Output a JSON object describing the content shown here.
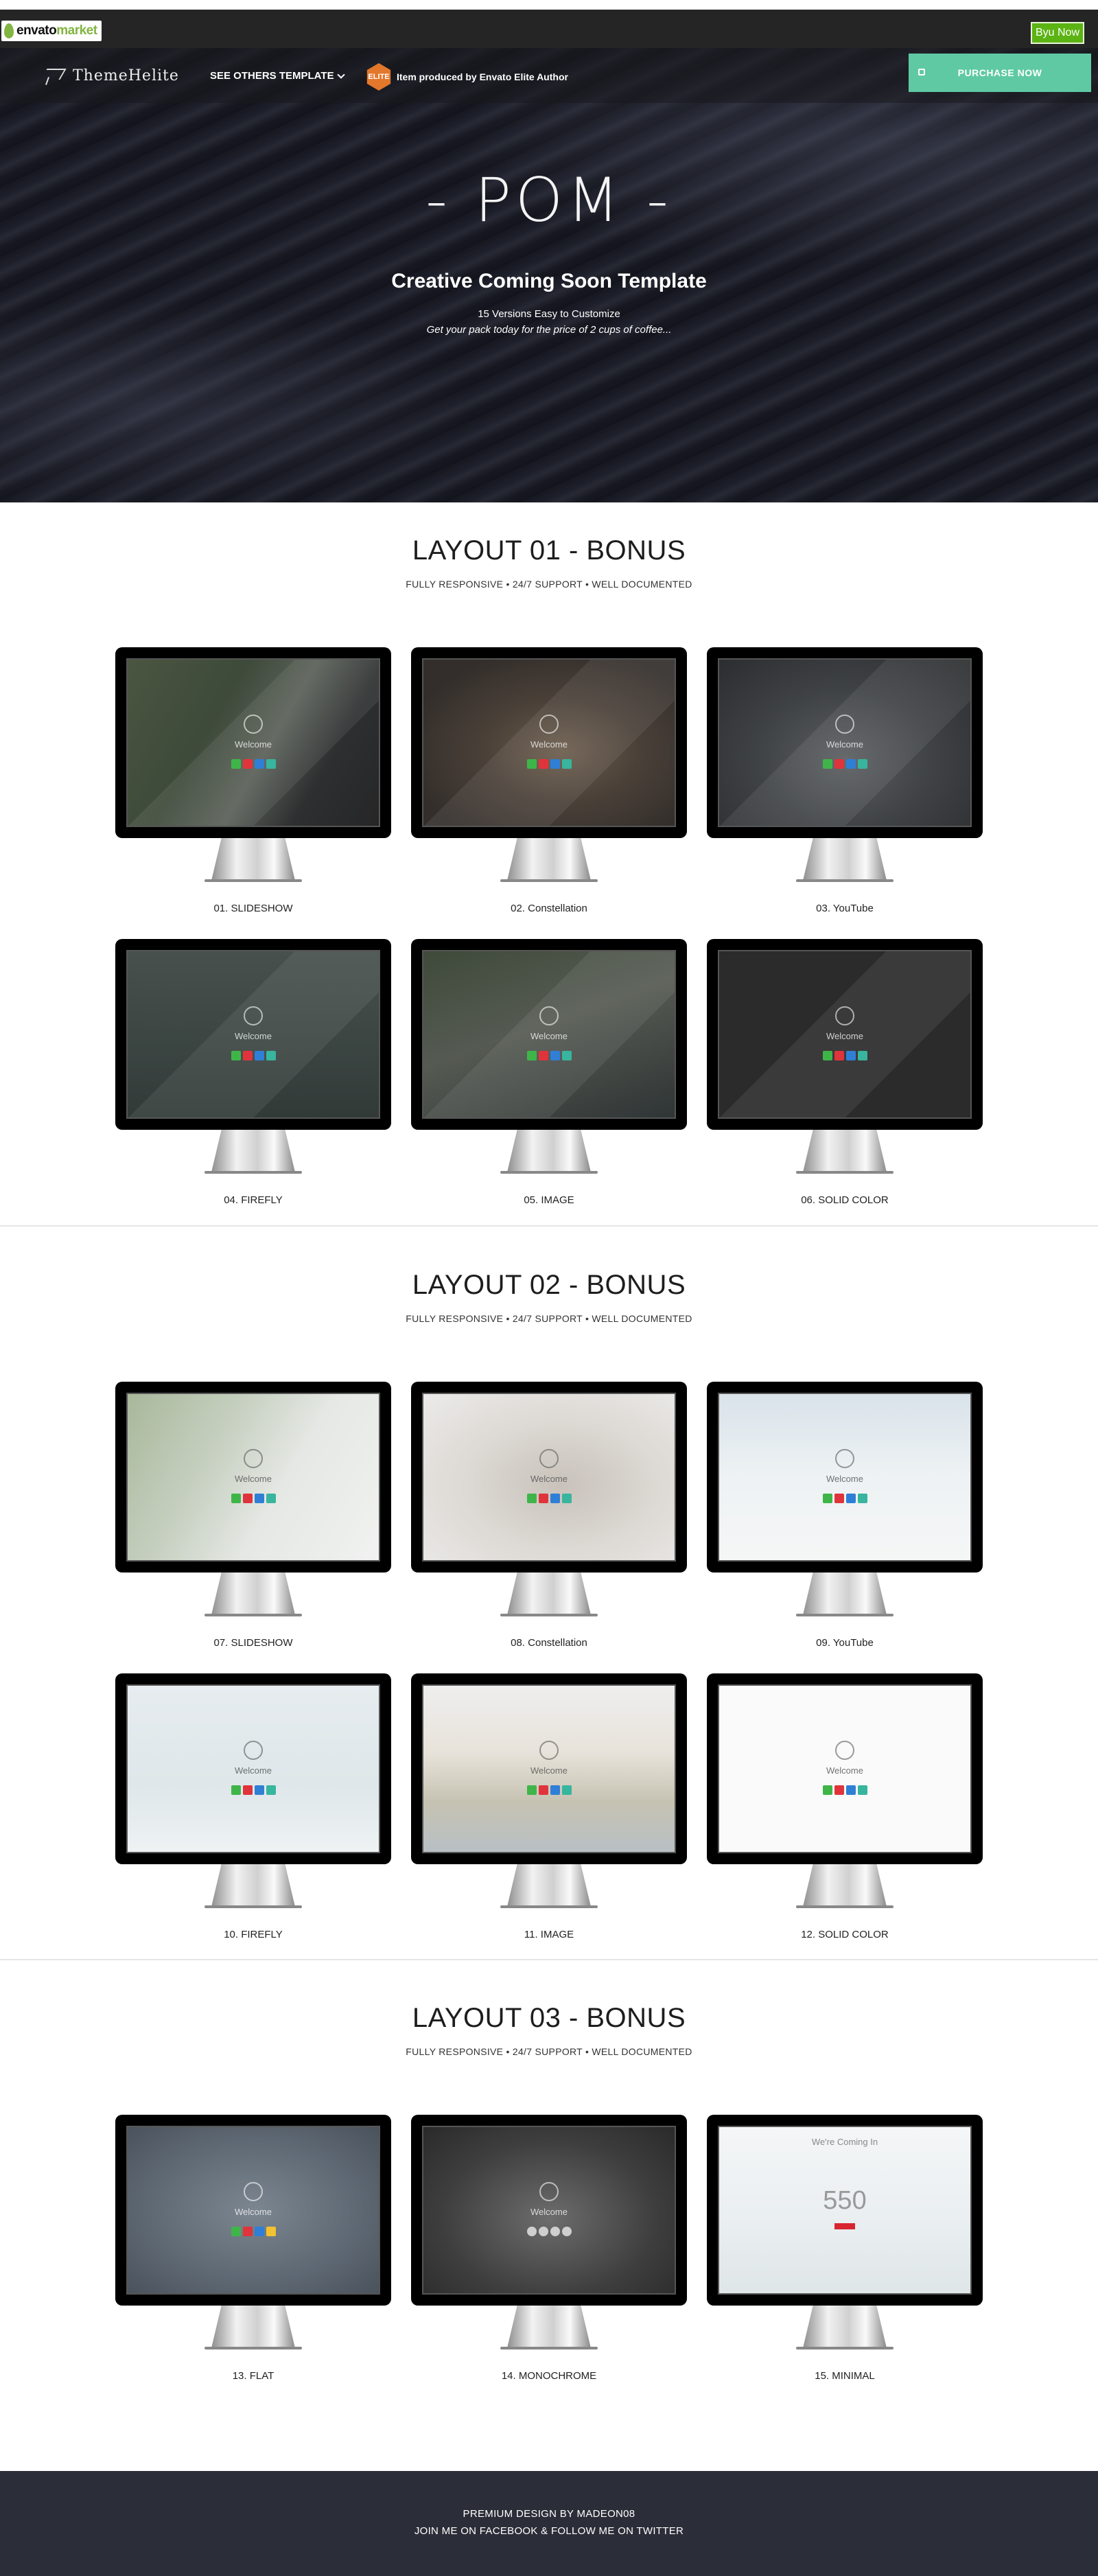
{
  "envato": {
    "brand_word": "envato",
    "brand_market": "market",
    "buy_label": "Byu Now"
  },
  "nav": {
    "brand": "ThemeHelite",
    "see_templates": "SEE OTHERS TEMPLATE",
    "author_badge": "ELITE",
    "author_text": "Item produced by Envato Elite Author",
    "purchase": "PURCHASE NOW"
  },
  "hero": {
    "title": "- POM -",
    "subtitle": "Creative Coming Soon Template",
    "line1": "15 Versions Easy to Customize",
    "line2": "Get your pack today for the price of 2 cups of coffee..."
  },
  "sections": [
    {
      "title": "LAYOUT 01 - BONUS",
      "subtitle": "FULLY RESPONSIVE • 24/7 SUPPORT • WELL DOCUMENTED",
      "cards": [
        {
          "label": "01. SLIDESHOW",
          "welcome": "Welcome"
        },
        {
          "label": "02. Constellation",
          "welcome": "Welcome"
        },
        {
          "label": "03. YouTube",
          "welcome": "Welcome"
        },
        {
          "label": "04. FIREFLY",
          "welcome": "Welcome"
        },
        {
          "label": "05. IMAGE",
          "welcome": "Welcome"
        },
        {
          "label": "06. SOLID COLOR",
          "welcome": "Welcome"
        }
      ]
    },
    {
      "title": "LAYOUT 02 - BONUS",
      "subtitle": "FULLY RESPONSIVE • 24/7 SUPPORT • WELL DOCUMENTED",
      "cards": [
        {
          "label": "07. SLIDESHOW",
          "welcome": "Welcome"
        },
        {
          "label": "08. Constellation",
          "welcome": "Welcome"
        },
        {
          "label": "09. YouTube",
          "welcome": "Welcome"
        },
        {
          "label": "10. FIREFLY",
          "welcome": "Welcome"
        },
        {
          "label": "11. IMAGE",
          "welcome": "Welcome"
        },
        {
          "label": "12. SOLID COLOR",
          "welcome": "Welcome"
        }
      ]
    },
    {
      "title": "LAYOUT 03 - BONUS",
      "subtitle": "FULLY RESPONSIVE • 24/7 SUPPORT • WELL DOCUMENTED",
      "cards": [
        {
          "label": "13. FLAT",
          "welcome": "Welcome"
        },
        {
          "label": "14. MONOCHROME",
          "welcome": "Welcome"
        },
        {
          "label": "15. MINIMAL",
          "mini_title": "We're Coming In",
          "mini_count": "550"
        }
      ]
    }
  ],
  "footer": {
    "line1": "PREMIUM DESIGN BY MADEON08",
    "line2": "JOIN ME ON FACEBOOK & FOLLOW ME ON TWITTER"
  },
  "colors": {
    "envato_green": "#82b541",
    "buy_green": "#5cb314",
    "purchase_teal": "#5fc9a4",
    "author_orange": "#e3772b",
    "footer_bg": "#2b2e38",
    "tile_green": "#3fb549",
    "tile_red": "#e0343c",
    "tile_blue": "#2f7fd6",
    "tile_teal": "#38b59e",
    "tile_yellow": "#f2c230"
  }
}
